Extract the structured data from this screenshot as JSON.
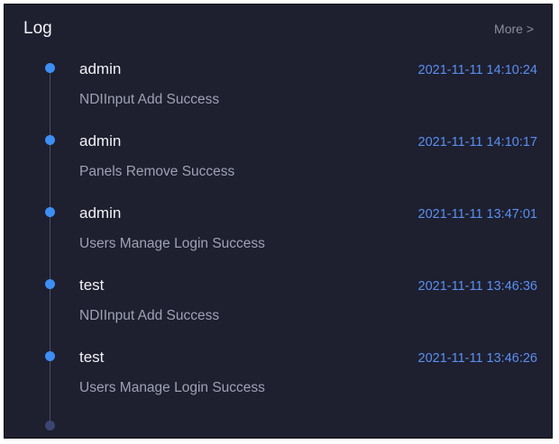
{
  "header": {
    "title": "Log",
    "more_label": "More >"
  },
  "log": {
    "entries": [
      {
        "user": "admin",
        "time": "2021-11-11 14:10:24",
        "message": "NDIInput Add Success"
      },
      {
        "user": "admin",
        "time": "2021-11-11 14:10:17",
        "message": "Panels Remove Success"
      },
      {
        "user": "admin",
        "time": "2021-11-11 13:47:01",
        "message": "Users Manage Login Success"
      },
      {
        "user": "test",
        "time": "2021-11-11 13:46:36",
        "message": "NDIInput Add Success"
      },
      {
        "user": "test",
        "time": "2021-11-11 13:46:26",
        "message": "Users Manage Login Success"
      }
    ]
  },
  "colors": {
    "background": "#1e1f2f",
    "accent": "#3d8ef5",
    "timestamp": "#5a8ff0",
    "message": "#9ea2b3"
  }
}
